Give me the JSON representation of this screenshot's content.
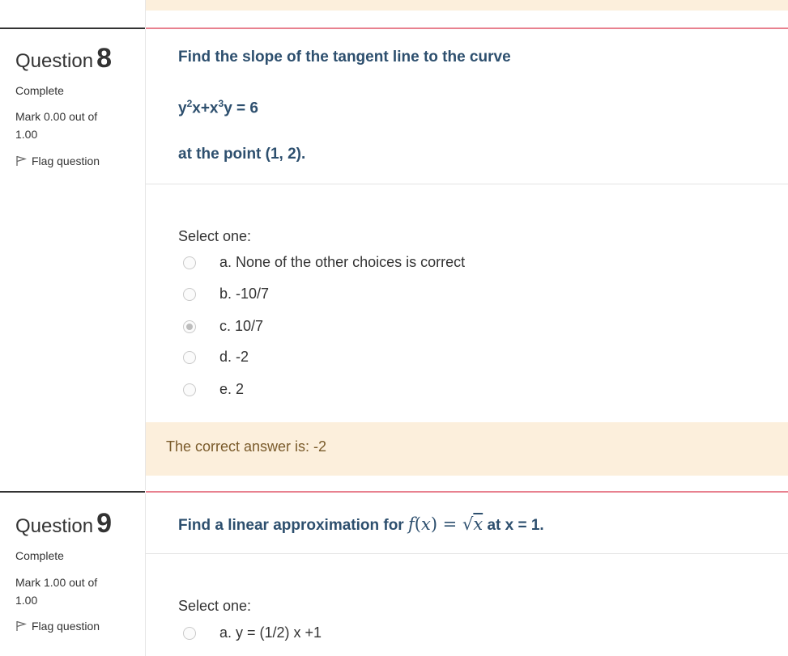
{
  "q8": {
    "label": "Question",
    "number": "8",
    "state": "Complete",
    "grade": "Mark 0.00 out of 1.00",
    "flag_label": "Flag question",
    "text_line1": "Find the slope of the tangent line to the curve",
    "text_line3": "at the point (1, 2).",
    "prompt": "Select one:",
    "options": [
      {
        "label": "a. None of the other choices is correct",
        "selected": false
      },
      {
        "label": "b. -10/7",
        "selected": false
      },
      {
        "label": "c. 10/7",
        "selected": true
      },
      {
        "label": "d. -2",
        "selected": false
      },
      {
        "label": "e. 2",
        "selected": false
      }
    ],
    "feedback": "The correct answer is: -2"
  },
  "q9": {
    "label": "Question",
    "number": "9",
    "state": "Complete",
    "grade": "Mark 1.00 out of 1.00",
    "flag_label": "Flag question",
    "text_prefix": "Find a linear approximation for",
    "text_suffix": "at x = 1.",
    "prompt": "Select one:",
    "options": [
      {
        "label": "a. y = (1/2) x +1",
        "selected": false
      }
    ]
  },
  "colors": {
    "question_text": "#2d4f6e",
    "feedback_bg": "#fcefdc",
    "accent_rule": "#e8818f"
  }
}
